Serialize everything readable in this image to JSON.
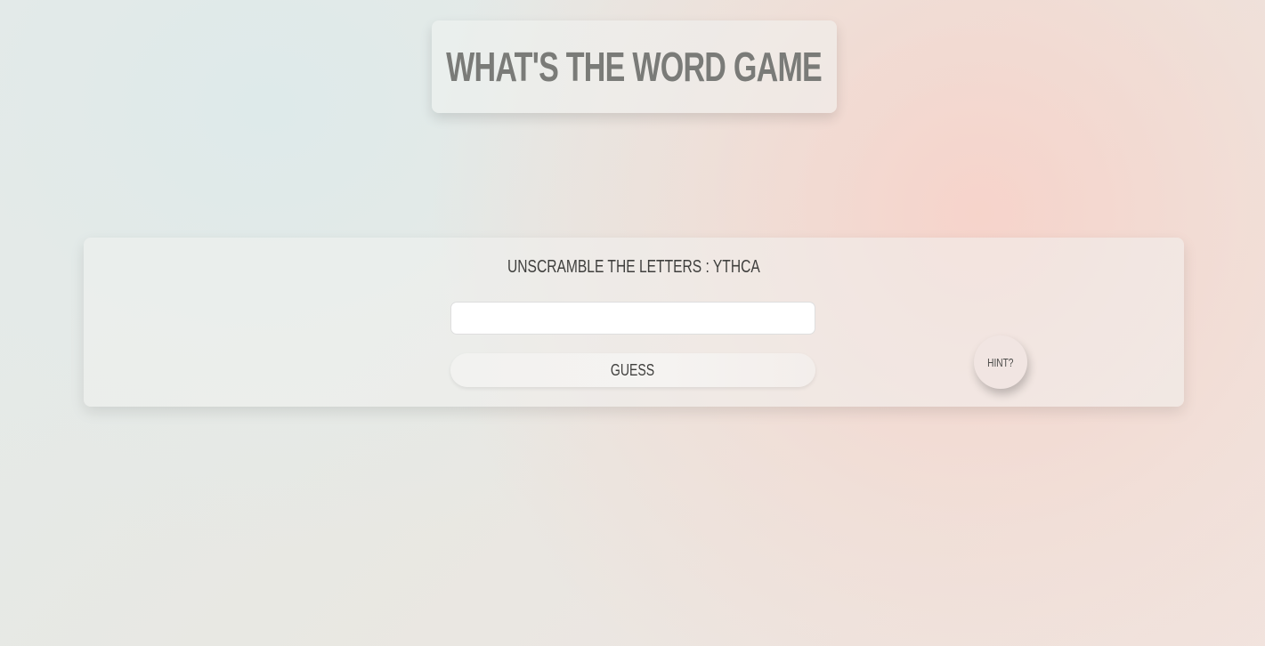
{
  "header": {
    "title": "WHAT'S THE WORD GAME"
  },
  "game": {
    "prompt": "UNSCRAMBLE THE LETTERS : YTHCA",
    "guess_input_value": "",
    "guess_input_placeholder": "",
    "guess_button_label": "GUESS",
    "hint_button_label": "HINT?"
  },
  "colors": {
    "title_text": "#7a7b78",
    "body_text": "#3f3f3d",
    "accent_blush": "#f7d4cc",
    "background_mint": "#e3ebea"
  }
}
